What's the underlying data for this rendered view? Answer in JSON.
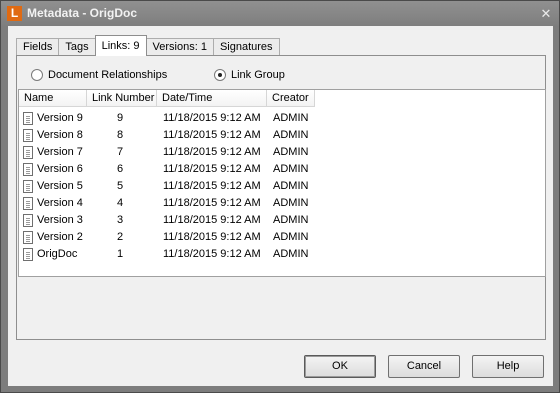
{
  "window": {
    "title": "Metadata - OrigDoc",
    "app_letter": "L",
    "close_glyph": "✕"
  },
  "tabs": [
    {
      "label": "Fields",
      "active": false
    },
    {
      "label": "Tags",
      "active": false
    },
    {
      "label": "Links: 9",
      "active": true
    },
    {
      "label": "Versions: 1",
      "active": false
    },
    {
      "label": "Signatures",
      "active": false
    }
  ],
  "radios": {
    "relationships": {
      "label": "Document Relationships",
      "checked": false
    },
    "link_group": {
      "label": "Link Group",
      "checked": true
    }
  },
  "list": {
    "columns": [
      "Name",
      "Link Number",
      "Date/Time",
      "Creator"
    ],
    "rows": [
      {
        "name": "Version 9",
        "link": "9",
        "datetime": "11/18/2015 9:12 AM",
        "creator": "ADMIN"
      },
      {
        "name": "Version 8",
        "link": "8",
        "datetime": "11/18/2015 9:12 AM",
        "creator": "ADMIN"
      },
      {
        "name": "Version 7",
        "link": "7",
        "datetime": "11/18/2015 9:12 AM",
        "creator": "ADMIN"
      },
      {
        "name": "Version 6",
        "link": "6",
        "datetime": "11/18/2015 9:12 AM",
        "creator": "ADMIN"
      },
      {
        "name": "Version 5",
        "link": "5",
        "datetime": "11/18/2015 9:12 AM",
        "creator": "ADMIN"
      },
      {
        "name": "Version 4",
        "link": "4",
        "datetime": "11/18/2015 9:12 AM",
        "creator": "ADMIN"
      },
      {
        "name": "Version 3",
        "link": "3",
        "datetime": "11/18/2015 9:12 AM",
        "creator": "ADMIN"
      },
      {
        "name": "Version 2",
        "link": "2",
        "datetime": "11/18/2015 9:12 AM",
        "creator": "ADMIN"
      },
      {
        "name": "OrigDoc",
        "link": "1",
        "datetime": "11/18/2015 9:12 AM",
        "creator": "ADMIN"
      }
    ]
  },
  "toolbar": [
    {
      "icon": "copy-documents-icon"
    },
    {
      "icon": "import-folder-icon"
    },
    {
      "icon": "remove-link-icon"
    },
    {
      "icon": "link-info-icon"
    }
  ],
  "buttons": {
    "ok": "OK",
    "cancel": "Cancel",
    "help": "Help"
  },
  "colors": {
    "titlebar": "#868686",
    "app_icon": "#e06a12",
    "folder": "#e6b52c",
    "arrow": "#3fa832"
  }
}
